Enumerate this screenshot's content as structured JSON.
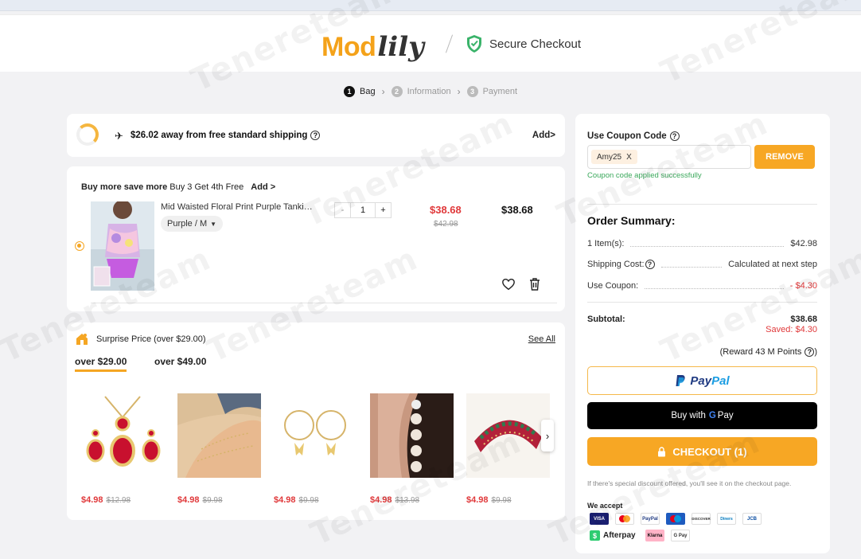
{
  "header": {
    "logo_mod": "Mod",
    "logo_lily": "lily",
    "secure_text": "Secure Checkout"
  },
  "steps": [
    {
      "num": "1",
      "label": "Bag"
    },
    {
      "num": "2",
      "label": "Information"
    },
    {
      "num": "3",
      "label": "Payment"
    }
  ],
  "shipping": {
    "text": "$26.02 away from free standard shipping",
    "add": "Add>"
  },
  "bag": {
    "promo_bold": "Buy more save more",
    "promo_text": "Buy 3 Get 4th Free",
    "promo_add": "Add >",
    "product_name": "Mid Waisted Floral Print Purple Tankini Set",
    "variant": "Purple / M",
    "qty_minus": "-",
    "qty": "1",
    "qty_plus": "+",
    "price_now": "$38.68",
    "price_old": "$42.98",
    "price_total": "$38.68"
  },
  "surprise": {
    "title": "Surprise Price (over $29.00)",
    "see_all": "See All",
    "tab1": "over $29.00",
    "tab2": "over $49.00",
    "items": [
      {
        "price": "$4.98",
        "old": "$12.98"
      },
      {
        "price": "$4.98",
        "old": "$9.98"
      },
      {
        "price": "$4.98",
        "old": "$9.98"
      },
      {
        "price": "$4.98",
        "old": "$13.98"
      },
      {
        "price": "$4.98",
        "old": "$9.98"
      }
    ]
  },
  "coupon": {
    "label": "Use Coupon Code",
    "code": "Amy25",
    "close": "X",
    "remove": "REMOVE",
    "success": "Coupon code applied successfully"
  },
  "summary": {
    "title": "Order Summary:",
    "items_label": "1 Item(s):",
    "items_val": "$42.98",
    "shipping_label": "Shipping Cost:",
    "shipping_val": "Calculated at next step",
    "coupon_label": "Use Coupon:",
    "coupon_val": "- $4.30",
    "subtotal_label": "Subtotal:",
    "subtotal_val": "$38.68",
    "saved": "Saved: $4.30",
    "reward": "(Reward 43 M Points"
  },
  "payment": {
    "paypal_p1": "Pay",
    "paypal_p2": "Pal",
    "gpay_text": "Buy with",
    "gpay_g": "G",
    "gpay_pay": "Pay",
    "checkout": "CHECKOUT (1)",
    "note": "If there's special discount offered, you'll see it on the checkout page.",
    "accept": "We accept",
    "methods": [
      "VISA",
      "MC",
      "PayPal",
      "Maestro",
      "DISCOVER",
      "Diners",
      "JCB"
    ],
    "afterpay": "Afterpay",
    "klarna": "Klarna",
    "gpay_small": "G Pay"
  },
  "watermark": "Tenereteam",
  "colors": {
    "accent": "#f7a724",
    "price_red": "#e0383a",
    "success_green": "#3aa85b"
  }
}
